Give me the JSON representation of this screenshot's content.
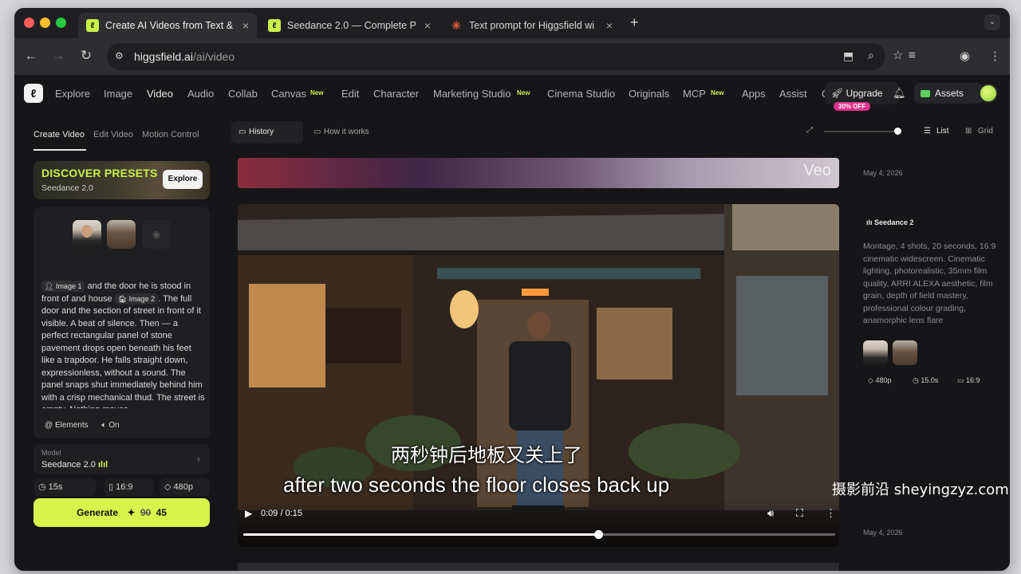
{
  "browser": {
    "tabs": [
      {
        "title": "Create AI Videos from Text &",
        "close": "×"
      },
      {
        "title": "Seedance 2.0 — Complete Pr",
        "close": "×"
      },
      {
        "title": "Text prompt for Higgsfield wi",
        "close": "×"
      }
    ],
    "new_tab": "+",
    "url_host": "higgsfield.ai",
    "url_path": "/ai/video"
  },
  "nav": {
    "items": [
      "Explore",
      "Image",
      "Video",
      "Audio",
      "Collab",
      "Canvas",
      "Edit",
      "Character",
      "Marketing Studio",
      "Cinema Studio",
      "Originals",
      "MCP",
      "Apps",
      "Assist",
      "C"
    ],
    "new_badge": "New",
    "upgrade": "Upgrade",
    "discount": "30% OFF",
    "assets": "Assets"
  },
  "left": {
    "subtabs": [
      "Create Video",
      "Edit Video",
      "Motion Control"
    ],
    "presets_title": "DISCOVER PRESETS",
    "presets_sub": "Seedance 2.0",
    "presets_button": "Explore",
    "prompt_chip1": "Image 1",
    "prompt_part1": " and the door he is stood in front of and house ",
    "prompt_chip2": "Image 2",
    "prompt_part2": ". The full door and the section of street in front of it visible. A beat of silence. Then — a perfect rectangular panel of stone pavement drops open beneath his feet like a trapdoor. He falls straight down, expressionless, without a sound. The panel snaps shut immediately behind him with a crisp mechanical thud. The street is empty. Nothing moves.",
    "elements_label": "Elements",
    "sound_label": "On",
    "model_label": "Model",
    "model_value": "Seedance 2.0",
    "duration": "15s",
    "aspect": "16:9",
    "resolution": "480p",
    "generate_label": "Generate",
    "generate_old_cost": "90",
    "generate_cost": "45"
  },
  "center": {
    "history": "History",
    "how_it_works": "How it works",
    "list_label": "List",
    "grid_label": "Grid",
    "banner_text": "Veo",
    "video_time": "0:09 / 0:15",
    "progress": 0.6
  },
  "right": {
    "date1": "May 4, 2026",
    "model": "Seedance 2",
    "description": "Montage, 4 shots, 20 seconds, 16:9 cinematic widescreen. Cinematic lighting, photorealistic, 35mm film quality, ARRI ALEXA aesthetic, film grain, depth of field mastery, professional colour grading, anamorphic lens flare",
    "meta_res": "480p",
    "meta_duration": "15.0s",
    "meta_aspect": "16:9",
    "date2": "May 4, 2026"
  },
  "overlay": {
    "subtitle_cn": "两秒钟后地板又关上了",
    "subtitle_en": "after two seconds the floor closes back up",
    "watermark": "摄影前沿 sheyingzyz.com"
  }
}
